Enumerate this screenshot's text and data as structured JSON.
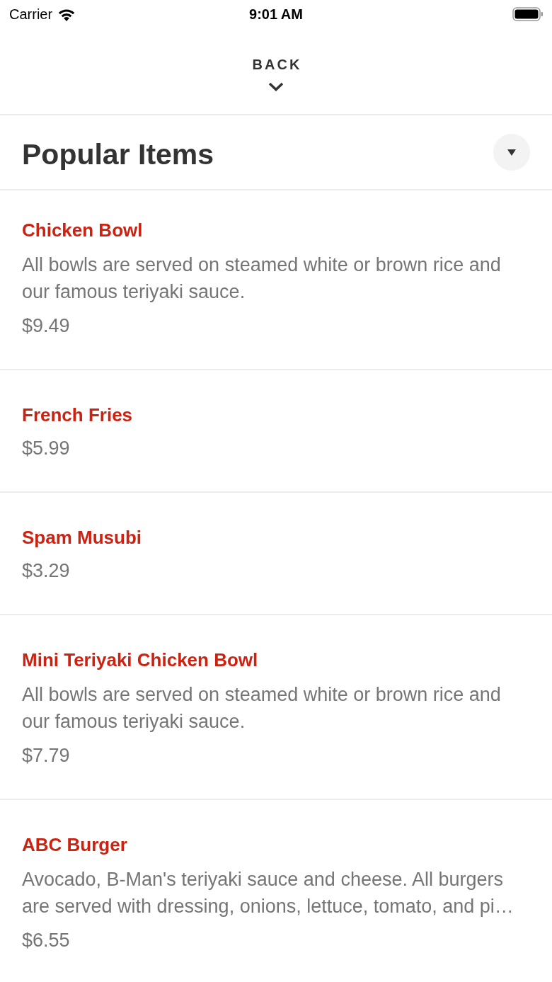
{
  "status_bar": {
    "carrier": "Carrier",
    "time": "9:01 AM"
  },
  "header": {
    "back_label": "BACK"
  },
  "section": {
    "title": "Popular Items"
  },
  "items": [
    {
      "name": "Chicken Bowl",
      "description": "All bowls are served on steamed white or brown rice and our famous teriyaki sauce.",
      "price": "$9.49"
    },
    {
      "name": "French Fries",
      "price": "$5.99"
    },
    {
      "name": "Spam Musubi",
      "price": "$3.29"
    },
    {
      "name": "Mini Teriyaki Chicken Bowl",
      "description": "All bowls are served on steamed white or brown rice and our famous teriyaki sauce.",
      "price": "$7.79"
    },
    {
      "name": "ABC Burger",
      "description": "Avocado, B-Man's teriyaki sauce and cheese. All burgers are served with dressing, onions, lettuce, tomato, and pi…",
      "price": "$6.55"
    }
  ]
}
